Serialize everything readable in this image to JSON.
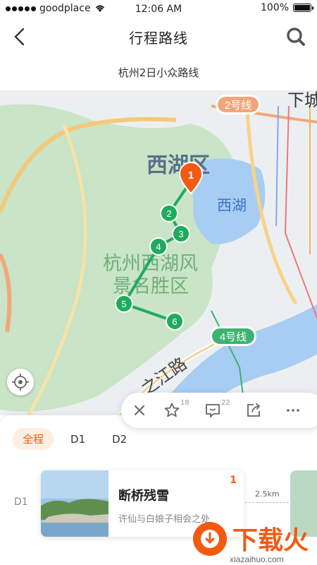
{
  "status": {
    "carrier": "goodplace",
    "time": "12:06 AM",
    "battery": "100%"
  },
  "nav": {
    "title": "行程路线",
    "back_icon": "chevron-left-icon",
    "search_icon": "search-icon"
  },
  "subtitle": "杭州2日小众路线",
  "map": {
    "labels": {
      "district": "西湖区",
      "lake": "西湖",
      "scenic_line1": "杭州西湖风",
      "scenic_line2": "景名胜区",
      "road": "之江路",
      "metro2": "2号线",
      "metro4": "4号线",
      "corner": "下城"
    },
    "pins": [
      "1",
      "2",
      "3",
      "4",
      "5",
      "6"
    ],
    "route_color": "#1fab5f",
    "pin_color": "#f25a12"
  },
  "toolbar": {
    "star_count": "18",
    "comment_count": "22"
  },
  "tabs": [
    {
      "label": "全程",
      "active": true
    },
    {
      "label": "D1"
    },
    {
      "label": "D2"
    }
  ],
  "day_label": "D1",
  "card": {
    "name": "断桥残雪",
    "desc": "许仙与白娘子相会之处",
    "index": "1"
  },
  "distance": "2.5km",
  "watermark": {
    "text": "下载火",
    "site": "xiazaihuo.com"
  }
}
